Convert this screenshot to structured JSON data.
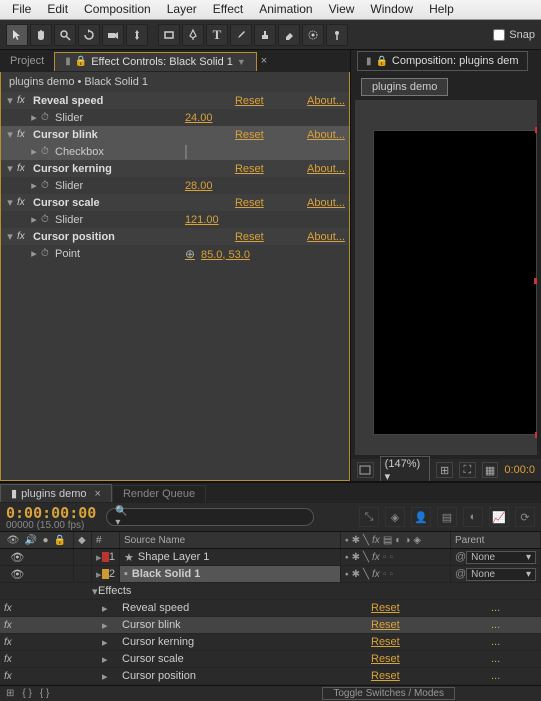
{
  "menu": [
    "File",
    "Edit",
    "Composition",
    "Layer",
    "Effect",
    "Animation",
    "View",
    "Window",
    "Help"
  ],
  "toolbar": {
    "snap_label": "Snap"
  },
  "ec": {
    "tab_project": "Project",
    "tab_fx_prefix": "Effect Controls:",
    "tab_fx_layer": "Black Solid 1",
    "breadcrumb_comp": "plugins demo",
    "breadcrumb_layer": "Black Solid 1",
    "reset": "Reset",
    "about": "About...",
    "effects": [
      {
        "name": "Reveal speed",
        "prop": "Slider",
        "value": "24.00",
        "sel": false,
        "type": "slider"
      },
      {
        "name": "Cursor blink",
        "prop": "Checkbox",
        "value": "",
        "sel": true,
        "type": "checkbox"
      },
      {
        "name": "Cursor kerning",
        "prop": "Slider",
        "value": "28.00",
        "sel": false,
        "type": "slider"
      },
      {
        "name": "Cursor scale",
        "prop": "Slider",
        "value": "121.00",
        "sel": false,
        "type": "slider"
      },
      {
        "name": "Cursor position",
        "prop": "Point",
        "value": "85.0, 53.0",
        "sel": false,
        "type": "point"
      }
    ]
  },
  "comp": {
    "tab_prefix": "Composition:",
    "tab_name": "plugins dem",
    "inner_tab": "plugins demo",
    "zoom": "(147%)",
    "time": "0:00:0"
  },
  "timeline": {
    "tab_active": "plugins demo",
    "tab_inactive": "Render Queue",
    "timecode": "0:00:00:00",
    "timecode_sub": "00000 (15.00 fps)",
    "search_placeholder": "",
    "col_num": "#",
    "col_source": "Source Name",
    "col_parent": "Parent",
    "layers": [
      {
        "num": "1",
        "name": "Shape Layer 1",
        "color": "red",
        "icon": "star",
        "parent": "None",
        "sel": false
      },
      {
        "num": "2",
        "name": "Black Solid 1",
        "color": "yellow",
        "icon": "solid",
        "parent": "None",
        "sel": true
      }
    ],
    "effects_label": "Effects",
    "effects": [
      {
        "name": "Reveal speed",
        "reset": "Reset",
        "sel": false
      },
      {
        "name": "Cursor blink",
        "reset": "Reset",
        "sel": true
      },
      {
        "name": "Cursor kerning",
        "reset": "Reset",
        "sel": false
      },
      {
        "name": "Cursor scale",
        "reset": "Reset",
        "sel": false
      },
      {
        "name": "Cursor position",
        "reset": "Reset",
        "sel": false
      }
    ],
    "toggle": "Toggle Switches / Modes"
  }
}
